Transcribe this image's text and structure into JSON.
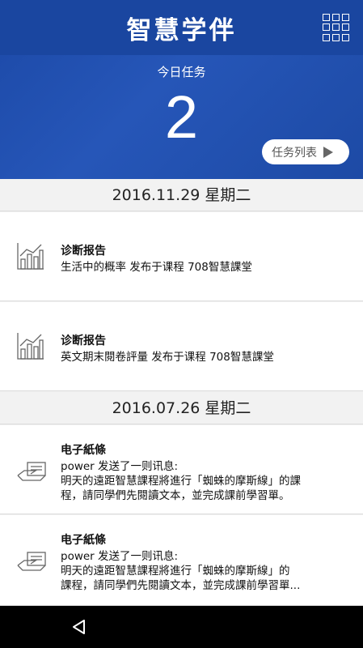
{
  "header": {
    "app_title": "智慧学伴",
    "menu_icon": "grid-menu-icon"
  },
  "today": {
    "label": "今日任务",
    "count": "2",
    "task_list_label": "任务列表"
  },
  "sections": [
    {
      "date": "2016.11.29 星期二",
      "items": [
        {
          "icon": "bar-chart-icon",
          "title": "诊断报告",
          "lines": [
            "生活中的概率 发布于课程 708智慧課堂"
          ]
        },
        {
          "icon": "bar-chart-icon",
          "title": "诊断报告",
          "lines": [
            "英文期末閱卷評量 发布于课程 708智慧課堂"
          ]
        }
      ]
    },
    {
      "date": "2016.07.26 星期二",
      "items": [
        {
          "icon": "hand-note-icon",
          "title": "电子紙條",
          "lines": [
            "power 发送了一则讯息:",
            "明天的遠距智慧課程將進行「蜘蛛的摩斯線」的課",
            "程，請同學們先閱讀文本，並完成課前學習單。"
          ]
        },
        {
          "icon": "hand-note-icon",
          "title": "电子紙條",
          "lines": [
            "power 发送了一则讯息:",
            "明天的遠距智慧課程將進行「蜘蛛的摩斯線」的",
            "課程，請同學們先閱讀文本，並完成課前學習單..."
          ]
        }
      ]
    }
  ],
  "navbar": {
    "back_icon": "back-triangle-icon"
  }
}
